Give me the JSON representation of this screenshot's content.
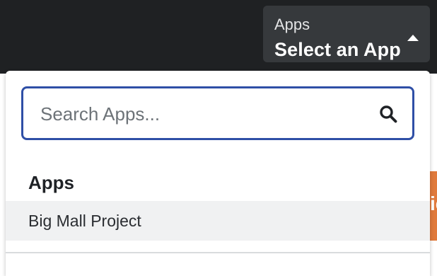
{
  "header": {
    "app_selector": {
      "label": "Apps",
      "value": "Select an App",
      "caret_icon": "caret-up-icon"
    }
  },
  "dropdown": {
    "search": {
      "placeholder": "Search Apps...",
      "value": "",
      "icon": "search-icon"
    },
    "section_title": "Apps",
    "items": [
      {
        "label": "Big Mall Project"
      }
    ]
  },
  "background": {
    "partial_text": "ic"
  },
  "colors": {
    "topbar": "#1f2123",
    "selector_bg": "#36393c",
    "search_border": "#2f4fa6",
    "item_hover": "#f0f1f2",
    "orange_accent": "#e07a3c"
  }
}
